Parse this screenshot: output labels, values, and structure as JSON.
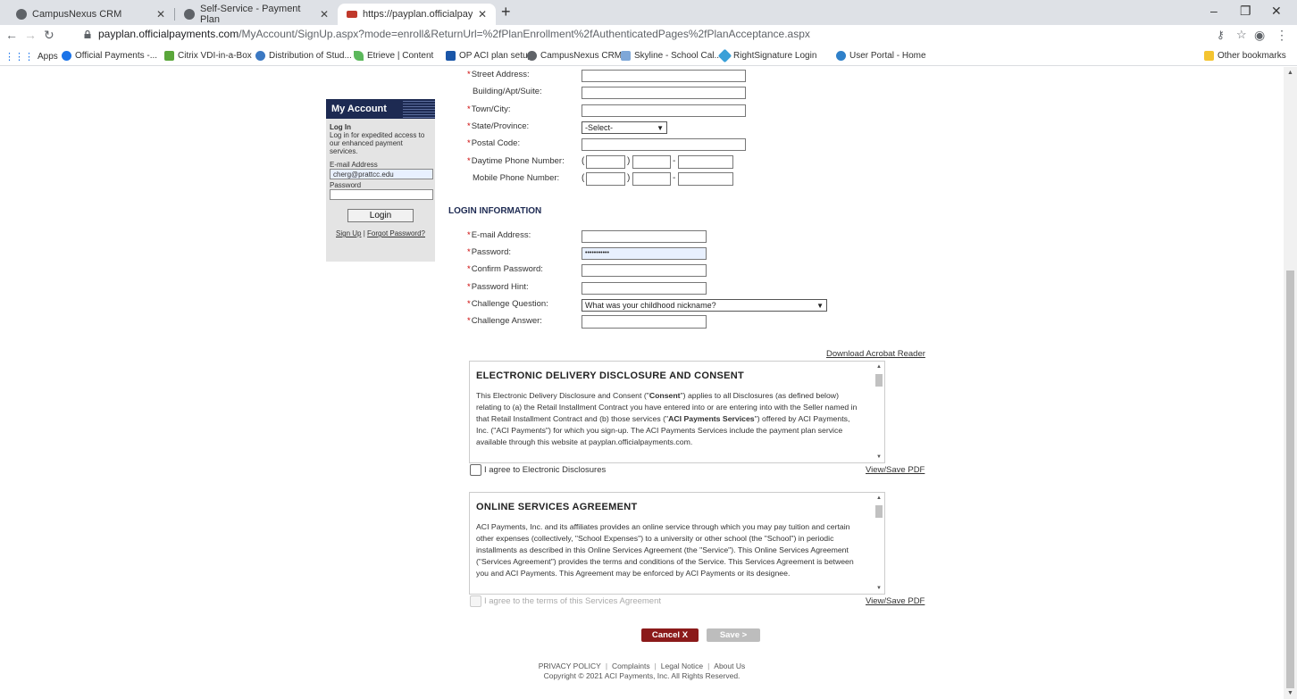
{
  "browser": {
    "tabs": [
      {
        "title": "CampusNexus CRM",
        "active": false
      },
      {
        "title": "Self-Service - Payment Plan",
        "active": false
      },
      {
        "title": "https://payplan.officialpayments",
        "active": true
      }
    ],
    "url_host": "payplan.officialpayments.com",
    "url_path": "/MyAccount/SignUp.aspx?mode=enroll&ReturnUrl=%2fPlanEnrollment%2fAuthenticatedPages%2fPlanAcceptance.aspx",
    "bookmarks": [
      "Apps",
      "Official Payments -...",
      "Citrix VDI-in-a-Box",
      "Distribution of Stud...",
      "Etrieve | Content",
      "OP ACI plan setup",
      "CampusNexus CRM",
      "Skyline - School Cal...",
      "RightSignature Login",
      "User Portal - Home"
    ],
    "other_bookmarks": "Other bookmarks"
  },
  "sidebar": {
    "title": "My Account",
    "login_heading": "Log In",
    "login_desc": "Log in for expedited access to our enhanced payment services.",
    "email_label": "E-mail Address",
    "email_value": "cherg@prattcc.edu",
    "password_label": "Password",
    "login_button": "Login",
    "signup_link": "Sign Up",
    "link_sep": "|",
    "forgot_link": "Forgot Password?"
  },
  "address": {
    "street_label": "Street Address:",
    "building_label": "Building/Apt/Suite:",
    "town_label": "Town/City:",
    "state_label": "State/Province:",
    "state_value": "-Select-",
    "postal_label": "Postal Code:",
    "day_phone_label": "Daytime Phone Number:",
    "mobile_phone_label": "Mobile Phone Number:"
  },
  "login_info": {
    "section_title": "LOGIN INFORMATION",
    "email_label": "E-mail Address:",
    "password_label": "Password:",
    "password_value": "•••••••••••",
    "confirm_label": "Confirm Password:",
    "hint_label": "Password Hint:",
    "question_label": "Challenge Question:",
    "question_value": "What was your childhood nickname?",
    "answer_label": "Challenge Answer:"
  },
  "download_reader": "Download Acrobat Reader",
  "disclosure": {
    "title": "ELECTRONIC DELIVERY DISCLOSURE AND CONSENT",
    "t1": "This Electronic Delivery Disclosure and Consent (\"",
    "b1": "Consent",
    "t2": "\") applies to all Disclosures (as defined below) relating to (a) the Retail Installment Contract you have entered into or are entering into with the Seller named in that Retail Installment Contract and (b) those services (\"",
    "b2": "ACI Payments Services",
    "t3": "\") offered by ACI Payments, Inc. (\"ACI Payments\") for which you sign-up. The ACI Payments Services include the payment plan service available through this website at payplan.officialpayments.com.",
    "agree_label": "I agree to Electronic Disclosures",
    "pdf_link": "View/Save PDF"
  },
  "services": {
    "title": "ONLINE SERVICES AGREEMENT",
    "body": "ACI Payments, Inc. and its affiliates provides an online service through which you may pay tuition and certain other expenses (collectively, \"School Expenses\") to a university or other school (the \"School\") in periodic installments as described in this Online Services Agreement (the \"Service\"). This Online Services Agreement (\"Services Agreement\") provides the terms and conditions of the Service. This Services Agreement is between you and ACI Payments. This Agreement may be enforced by ACI Payments or its designee.",
    "agree_label": "I agree to the terms of this Services Agreement",
    "pdf_link": "View/Save PDF"
  },
  "buttons": {
    "cancel": "Cancel X",
    "save": "Save >"
  },
  "footer": {
    "links": [
      "PRIVACY POLICY",
      "Complaints",
      "Legal Notice",
      "About Us"
    ],
    "copyright": "Copyright © 2021 ACI Payments, Inc. All Rights Reserved."
  }
}
